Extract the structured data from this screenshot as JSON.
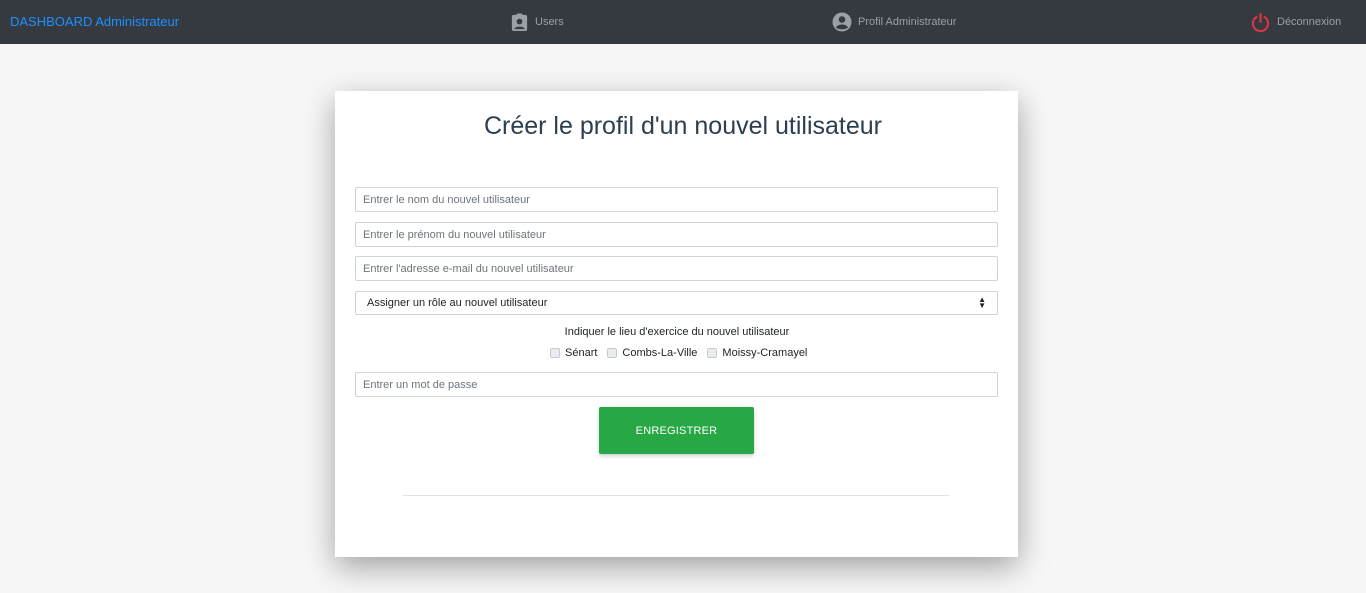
{
  "navbar": {
    "brand": "DASHBOARD Administrateur",
    "users_label": "Users",
    "profile_label": "Profil Administrateur",
    "logout_label": "Déconnexion",
    "colors": {
      "background": "#343a40",
      "brand": "#1e90ff",
      "logout_icon": "#dc3545"
    }
  },
  "form": {
    "title": "Créer le profil d'un nouvel utilisateur",
    "nom_placeholder": "Entrer le nom du nouvel utilisateur",
    "prenom_placeholder": "Entrer le prénom du nouvel utilisateur",
    "email_placeholder": "Entrer l'adresse e-mail du nouvel utilisateur",
    "role_select": {
      "selected": "Assigner un rôle au nouvel utilisateur"
    },
    "lieu_label": "Indiquer le lieu d'exercice du nouvel utilisateur",
    "lieux": [
      {
        "label": "Sénart",
        "checked": false
      },
      {
        "label": "Combs-La-Ville",
        "checked": false
      },
      {
        "label": "Moissy-Cramayel",
        "checked": false
      }
    ],
    "password_placeholder": "Entrer un mot de passe",
    "submit_label": "ENREGISTRER",
    "submit_color": "#28a745"
  },
  "icons": {
    "users": "clipboard-user-icon",
    "profile": "user-circle-icon",
    "logout": "power-icon"
  }
}
